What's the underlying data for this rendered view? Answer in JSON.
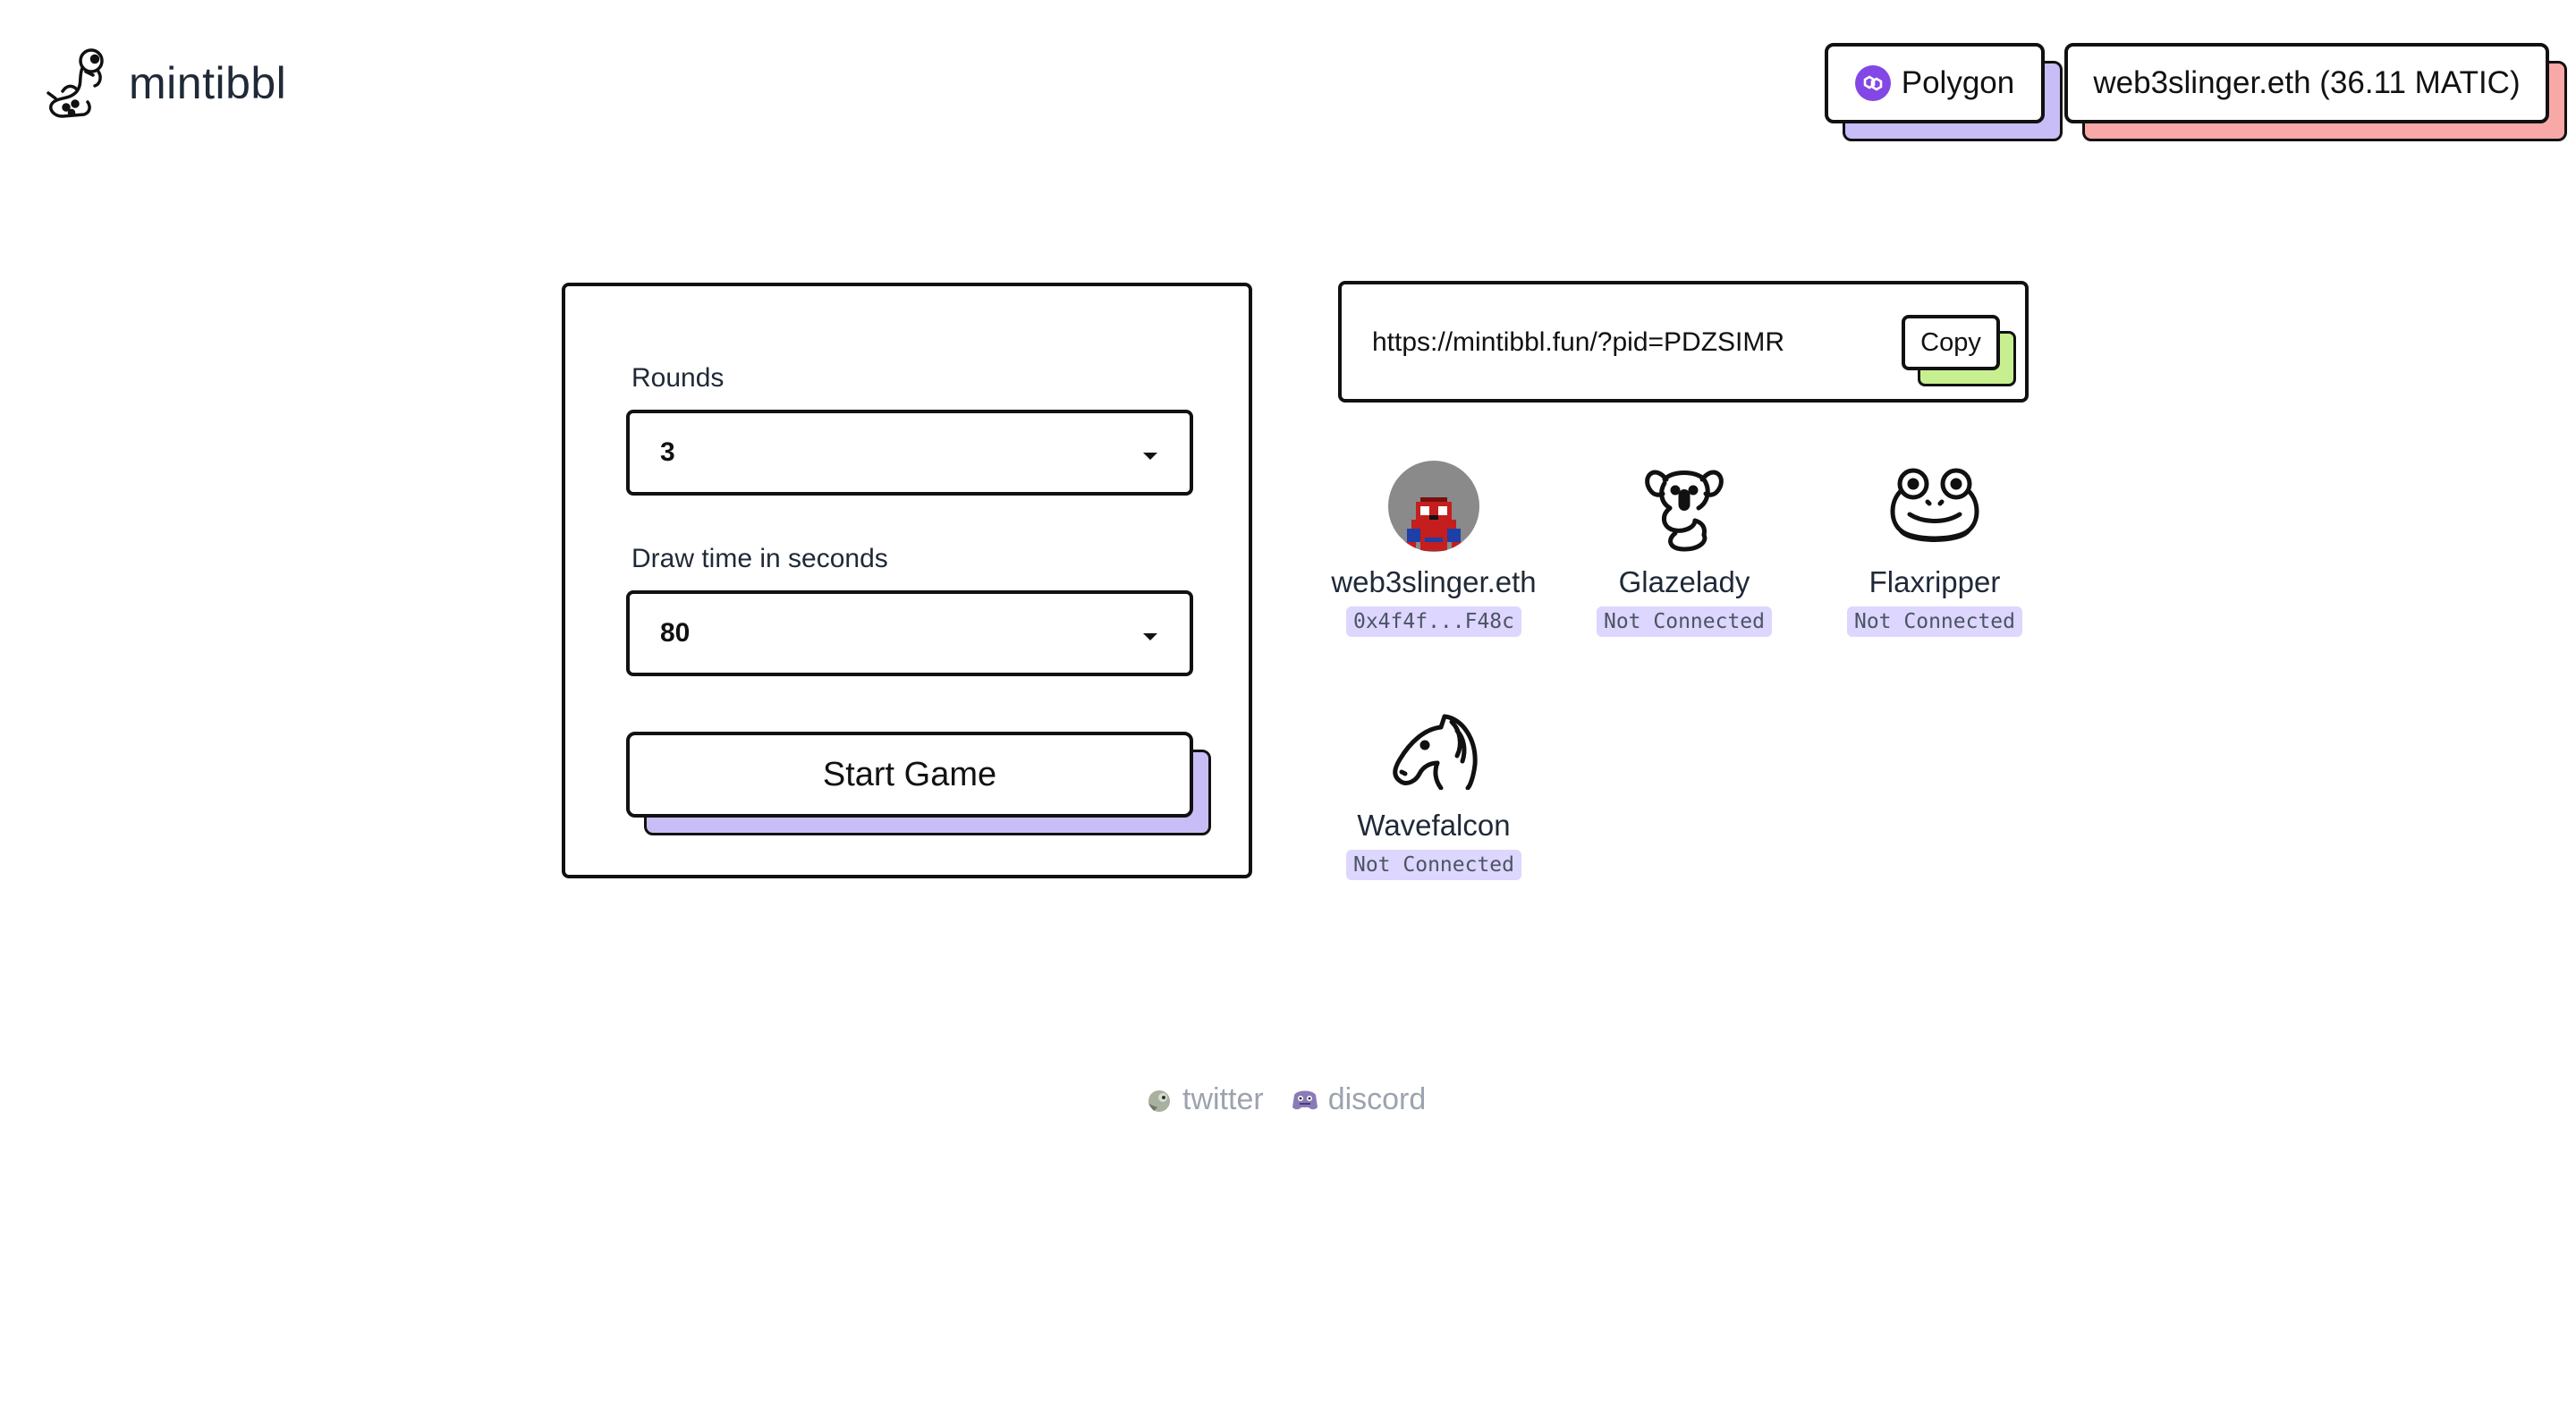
{
  "header": {
    "logo_text": "mintibbl",
    "network_label": "Polygon",
    "wallet_label": "web3slinger.eth (36.11 MATIC)",
    "colors": {
      "network_accent": "#8247e5",
      "network_shadow": "#c9bdf7",
      "wallet_shadow": "#f9a8a8"
    }
  },
  "settings": {
    "rounds_label": "Rounds",
    "rounds_value": "3",
    "draw_time_label": "Draw time in seconds",
    "draw_time_value": "80",
    "start_button": "Start Game"
  },
  "invite": {
    "url": "https://mintibbl.fun/?pid=PDZSIMR",
    "copy_label": "Copy",
    "copy_shadow_color": "#c8ef8f"
  },
  "players": [
    {
      "name": "web3slinger.eth",
      "status": "0x4f4f...F48c",
      "avatar": "pixel-spiderman-avatar"
    },
    {
      "name": "Glazelady",
      "status": "Not Connected",
      "avatar": "koala-icon"
    },
    {
      "name": "Flaxripper",
      "status": "Not Connected",
      "avatar": "frog-icon"
    },
    {
      "name": "Wavefalcon",
      "status": "Not Connected",
      "avatar": "horse-icon"
    }
  ],
  "footer": {
    "twitter_label": "twitter",
    "discord_label": "discord"
  }
}
